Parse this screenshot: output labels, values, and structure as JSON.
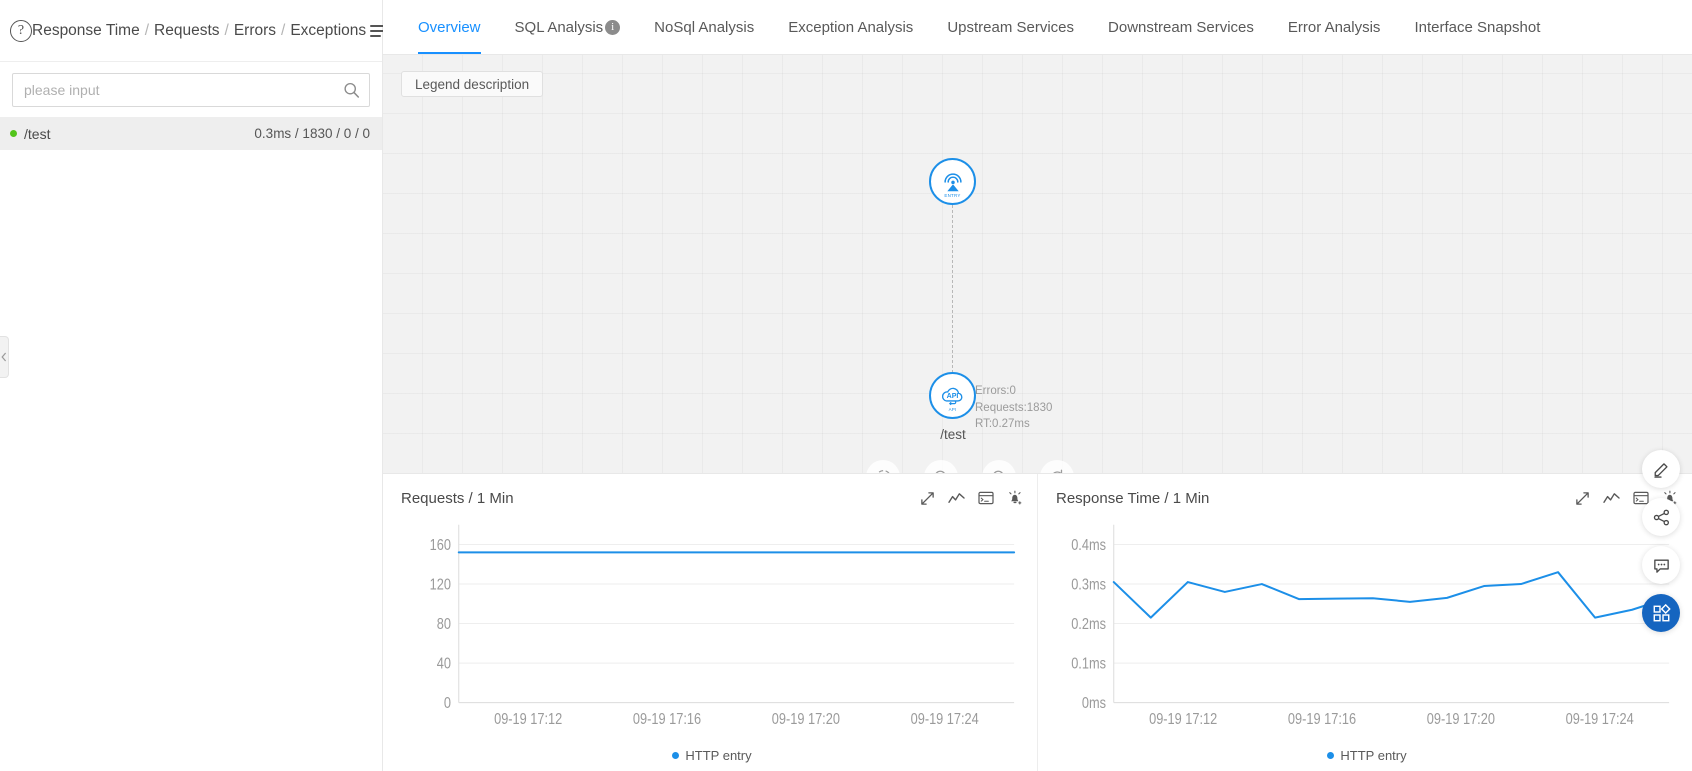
{
  "left_panel": {
    "help_icon": "question-circle-icon",
    "metrics_breadcrumb": [
      "Response Time",
      "Requests",
      "Errors",
      "Exceptions"
    ],
    "separator": "/",
    "list_toggle_icon": "list-menu-icon",
    "search": {
      "placeholder": "please input",
      "value": "",
      "icon": "search-icon"
    },
    "services": [
      {
        "name": "/test",
        "stats": "0.3ms / 1830 / 0 / 0",
        "status_color": "#52c41a"
      }
    ],
    "collapse_handle_icon": "chevron-left-icon"
  },
  "tabs": [
    {
      "label": "Overview",
      "active": true,
      "badge": ""
    },
    {
      "label": "SQL Analysis",
      "active": false,
      "badge": "i"
    },
    {
      "label": "NoSql Analysis",
      "active": false,
      "badge": ""
    },
    {
      "label": "Exception Analysis",
      "active": false,
      "badge": ""
    },
    {
      "label": "Upstream Services",
      "active": false,
      "badge": ""
    },
    {
      "label": "Downstream Services",
      "active": false,
      "badge": ""
    },
    {
      "label": "Error Analysis",
      "active": false,
      "badge": ""
    },
    {
      "label": "Interface Snapshot",
      "active": false,
      "badge": ""
    }
  ],
  "topology": {
    "legend_button": "Legend description",
    "nodes": [
      {
        "id": "entry",
        "caption": "ENTRY",
        "icon": "broadcast-tower-icon",
        "label": ""
      },
      {
        "id": "api",
        "caption": "API",
        "icon": "api-cloud-icon",
        "label": "/test"
      }
    ],
    "node_metrics": {
      "errors": "Errors:0",
      "requests": "Requests:1830",
      "rt": "RT:0.27ms"
    },
    "tools": [
      {
        "name": "locate-icon"
      },
      {
        "name": "zoom-in-icon"
      },
      {
        "name": "zoom-out-icon"
      },
      {
        "name": "refresh-icon"
      }
    ],
    "accent_color": "#1c8fe8"
  },
  "chart_data": [
    {
      "type": "line",
      "title": "Requests / 1 Min",
      "xlabel": "",
      "ylabel": "",
      "ylim": [
        0,
        180
      ],
      "yticks": [
        0,
        40,
        80,
        120,
        160
      ],
      "ytick_labels": [
        "0",
        "40",
        "80",
        "120",
        "160"
      ],
      "xtick_labels": [
        "09-19 17:12",
        "09-19 17:16",
        "09-19 17:20",
        "09-19 17:24"
      ],
      "grid": true,
      "legend": [
        "HTTP entry"
      ],
      "legend_position": "bottom",
      "color": "#1c8fe8",
      "series": [
        {
          "name": "HTTP entry",
          "values": [
            152,
            152,
            152,
            152,
            152,
            152,
            152,
            152,
            152,
            152,
            152,
            152,
            152,
            152,
            152,
            152,
            152,
            152,
            152,
            152
          ]
        }
      ]
    },
    {
      "type": "line",
      "title": "Response Time / 1 Min",
      "xlabel": "",
      "ylabel": "",
      "ylim": [
        0,
        0.45
      ],
      "yticks": [
        0,
        0.1,
        0.2,
        0.3,
        0.4
      ],
      "ytick_labels": [
        "0ms",
        "0.1ms",
        "0.2ms",
        "0.3ms",
        "0.4ms"
      ],
      "xtick_labels": [
        "09-19 17:12",
        "09-19 17:16",
        "09-19 17:20",
        "09-19 17:24"
      ],
      "grid": true,
      "legend": [
        "HTTP entry"
      ],
      "legend_position": "bottom",
      "color": "#1c8fe8",
      "series": [
        {
          "name": "HTTP entry",
          "values": [
            0.305,
            0.215,
            0.305,
            0.28,
            0.3,
            0.262,
            0.263,
            0.264,
            0.255,
            0.265,
            0.295,
            0.3,
            0.33,
            0.215,
            0.235,
            0.265
          ]
        }
      ]
    }
  ],
  "chart_actions": [
    {
      "name": "expand-icon"
    },
    {
      "name": "line-chart-icon"
    },
    {
      "name": "table-view-icon"
    },
    {
      "name": "alarm-icon"
    }
  ],
  "rail": [
    {
      "name": "edit-pencil-icon",
      "primary": false
    },
    {
      "name": "share-icon",
      "primary": false
    },
    {
      "name": "feedback-comment-icon",
      "primary": false
    },
    {
      "name": "apps-grid-icon",
      "primary": true
    }
  ]
}
